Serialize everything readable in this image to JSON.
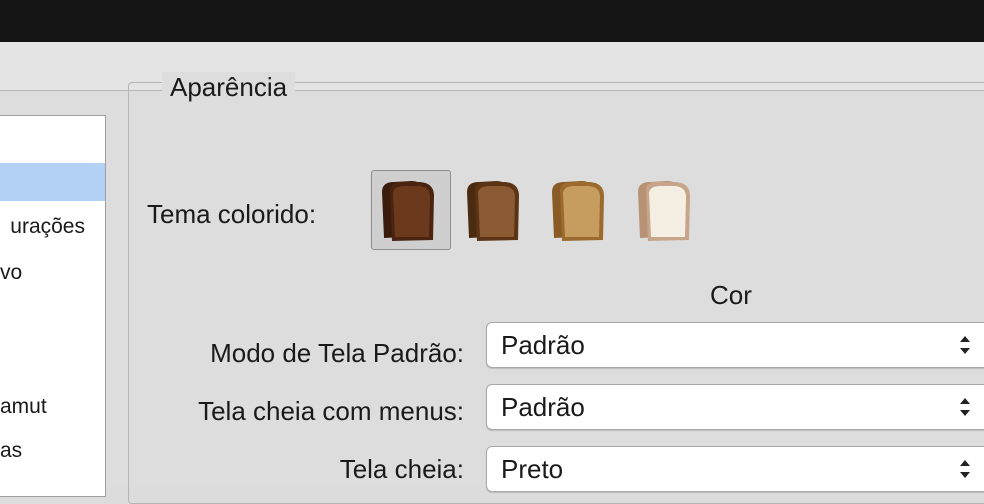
{
  "sidebar": {
    "items": [
      {
        "label": "urações"
      },
      {
        "label": "vo"
      },
      {
        "label": "amut"
      },
      {
        "label": "as"
      }
    ]
  },
  "appearance": {
    "group_title": "Aparência",
    "theme_label": "Tema colorido:",
    "themes": [
      {
        "name": "dark-toast",
        "selected": true,
        "crust": "#4a2411",
        "face": "#6b3a1c"
      },
      {
        "name": "medium-toast",
        "selected": false,
        "crust": "#5a3415",
        "face": "#8a5a33"
      },
      {
        "name": "light-toast",
        "selected": false,
        "crust": "#9b6a2e",
        "face": "#c79d5f"
      },
      {
        "name": "white-bread",
        "selected": false,
        "crust": "#c7a58a",
        "face": "#f4eee3"
      }
    ],
    "column_header": "Cor",
    "rows": [
      {
        "label": "Modo de Tela Padrão:",
        "value": "Padrão"
      },
      {
        "label": "Tela cheia com menus:",
        "value": "Padrão"
      },
      {
        "label": "Tela cheia:",
        "value": "Preto"
      }
    ]
  }
}
